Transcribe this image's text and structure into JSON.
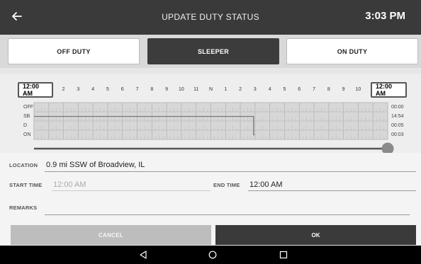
{
  "header": {
    "title": "UPDATE DUTY STATUS",
    "clock": "3:03 PM"
  },
  "status_buttons": {
    "off_duty": "OFF DUTY",
    "sleeper": "SLEEPER",
    "on_duty": "ON DUTY",
    "selected": "sleeper"
  },
  "timeline": {
    "start_label": "12:00 AM",
    "end_label": "12:00 AM",
    "hours": [
      "2",
      "3",
      "4",
      "5",
      "6",
      "7",
      "8",
      "9",
      "10",
      "11",
      "N",
      "1",
      "2",
      "3",
      "4",
      "5",
      "6",
      "7",
      "8",
      "9",
      "10"
    ],
    "rows": [
      {
        "label": "OFF",
        "total": "00:00"
      },
      {
        "label": "SB",
        "total": "14:54"
      },
      {
        "label": "D",
        "total": "00:05"
      },
      {
        "label": "ON",
        "total": "00:03"
      }
    ],
    "slider_position": 1.0
  },
  "form": {
    "location_label": "LOCATION",
    "location_value": "0.9 mi SSW of Broadview, IL",
    "start_time_label": "START TIME",
    "start_time_placeholder": "12:00 AM",
    "end_time_label": "END TIME",
    "end_time_value": "12:00 AM",
    "remarks_label": "REMARKS",
    "remarks_value": ""
  },
  "actions": {
    "cancel": "CANCEL",
    "ok": "OK"
  },
  "colors": {
    "header_bg": "#3a3a3a",
    "selected_btn_bg": "#3c3c3c",
    "grid_bg": "#d7d7d7",
    "line_color": "#777777"
  }
}
